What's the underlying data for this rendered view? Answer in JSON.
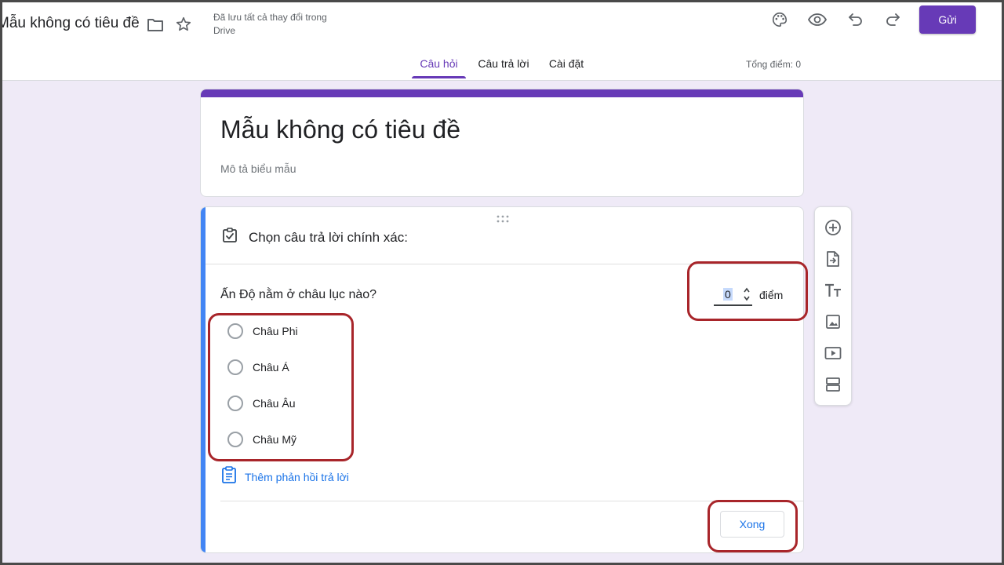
{
  "header": {
    "form_title": "Mẫu không có tiêu đề",
    "save_status": "Đã lưu tất cả thay đổi trong Drive",
    "send_label": "Gửi",
    "icons": [
      "folder-icon",
      "star-icon",
      "palette-icon",
      "eye-icon",
      "undo-icon",
      "redo-icon"
    ]
  },
  "tabs": [
    {
      "label": "Câu hỏi",
      "active": true
    },
    {
      "label": "Câu trả lời",
      "active": false
    },
    {
      "label": "Cài đặt",
      "active": false
    }
  ],
  "total_points": "Tổng điểm: 0",
  "title_card": {
    "title": "Mẫu không có tiêu đề",
    "description_placeholder": "Mô tả biểu mẫu"
  },
  "question_card": {
    "answer_key_label": "Chọn câu trả lời chính xác:",
    "question": "Ấn Độ nằm ở châu lục nào?",
    "points_value": "0",
    "points_unit": "điểm",
    "options": [
      "Châu Phi",
      "Châu Á",
      "Châu Âu",
      "Châu Mỹ"
    ],
    "feedback_label": "Thêm phản hồi trả lời",
    "done_label": "Xong"
  },
  "toolbar": {
    "icons": [
      "add-question-icon",
      "import-questions-icon",
      "add-title-icon",
      "add-image-icon",
      "add-video-icon",
      "add-section-icon"
    ]
  },
  "colors": {
    "accent": "#673ab7",
    "question_bar": "#4285f4",
    "link": "#1a73e8",
    "highlight": "#a8252a",
    "background": "#efeaf7"
  }
}
